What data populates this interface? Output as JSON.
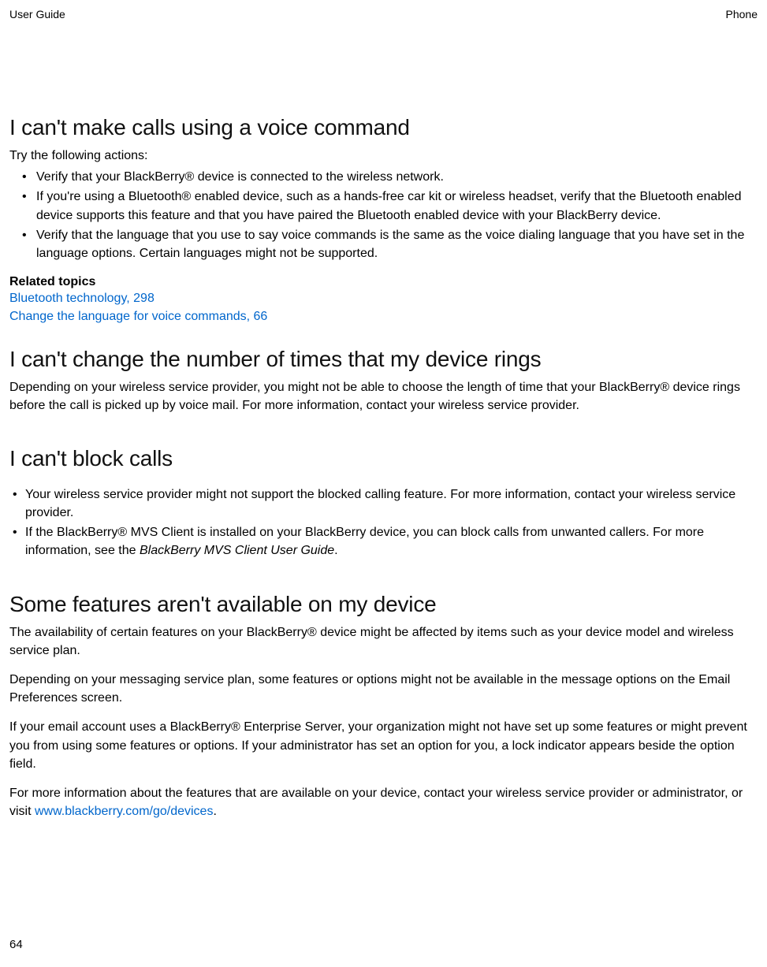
{
  "header": {
    "left": "User Guide",
    "right": "Phone"
  },
  "sections": {
    "s1": {
      "title": "I can't make calls using a voice command",
      "intro": "Try the following actions:",
      "bullets": [
        "Verify that your BlackBerry® device is connected to the wireless network.",
        "If you're using a Bluetooth® enabled device, such as a hands-free car kit or wireless headset, verify that the Bluetooth enabled device supports this feature and that you have paired the Bluetooth enabled device with your BlackBerry device.",
        "Verify that the language that you use to say voice commands is the same as the voice dialing language that you have set in the language options. Certain languages might not be supported."
      ],
      "related_title": "Related topics",
      "related_links": [
        "Bluetooth technology, 298",
        "Change the language for voice commands, 66"
      ]
    },
    "s2": {
      "title": "I can't change the number of times that my device rings",
      "body": "Depending on your wireless service provider, you might not be able to choose the length of time that your BlackBerry® device rings before the call is picked up by voice mail. For more information, contact your wireless service provider."
    },
    "s3": {
      "title": "I can't block calls",
      "bullets": [
        "Your wireless service provider might not support the blocked calling feature. For more information, contact your wireless service provider.",
        "If the BlackBerry® MVS Client is installed on your BlackBerry device, you can block calls from unwanted callers. For more information, see the "
      ],
      "bullet2_italic": "BlackBerry MVS Client User Guide",
      "bullet2_tail": "."
    },
    "s4": {
      "title": "Some features aren't available on my device",
      "p1": "The availability of certain features on your BlackBerry® device might be affected by items such as your device model and wireless service plan.",
      "p2": "Depending on your messaging service plan, some features or options might not be available in the message options on the Email Preferences screen.",
      "p3": "If your email account uses a BlackBerry® Enterprise Server, your organization might not have set up some features or might prevent you from using some features or options. If your administrator has set an option for you, a lock indicator appears beside the option field.",
      "p4_pre": "For more information about the features that are available on your device, contact your wireless service provider or administrator, or visit ",
      "p4_link": "www.blackberry.com/go/devices",
      "p4_post": "."
    }
  },
  "page_number": "64"
}
